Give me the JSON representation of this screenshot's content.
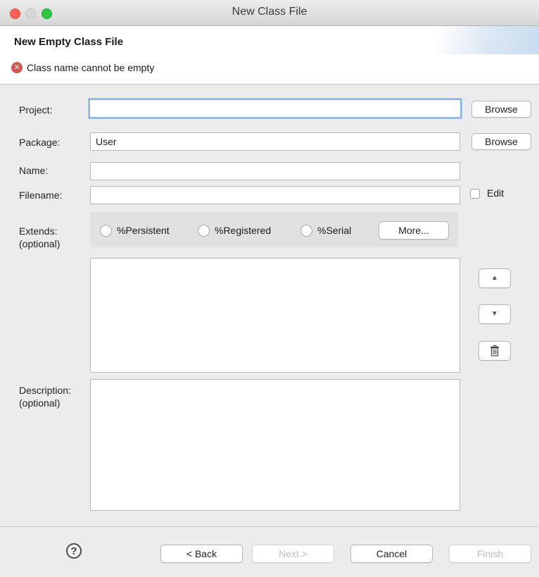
{
  "window": {
    "title": "New Class File"
  },
  "header": {
    "title": "New Empty Class File",
    "error_message": "Class name cannot be empty",
    "error_icon": "error-x-icon"
  },
  "form": {
    "project": {
      "label": "Project:",
      "value": "",
      "browse_label": "Browse"
    },
    "package": {
      "label": "Package:",
      "value": "User",
      "browse_label": "Browse"
    },
    "name": {
      "label": "Name:",
      "value": ""
    },
    "filename": {
      "label": "Filename:",
      "value": "",
      "edit_label": "Edit",
      "edit_checked": false
    },
    "extends": {
      "label_line1": "Extends:",
      "label_line2": "(optional)",
      "options": [
        "%Persistent",
        "%Registered",
        "%Serial"
      ],
      "more_label": "More..."
    },
    "list_controls": {
      "up_icon": "triangle-up-icon",
      "down_icon": "triangle-down-icon",
      "delete_icon": "trash-icon"
    },
    "description": {
      "label_line1": "Description:",
      "label_line2": "(optional)",
      "value": ""
    }
  },
  "footer": {
    "help_symbol": "?",
    "back_label": "< Back",
    "next_label": "Next >",
    "cancel_label": "Cancel",
    "finish_label": "Finish",
    "next_enabled": false,
    "finish_enabled": false
  },
  "colors": {
    "error_red": "#d9534f",
    "focus_blue": "#8fb3e6",
    "close_red": "#fc5f57",
    "maximize_green": "#2ac940"
  }
}
